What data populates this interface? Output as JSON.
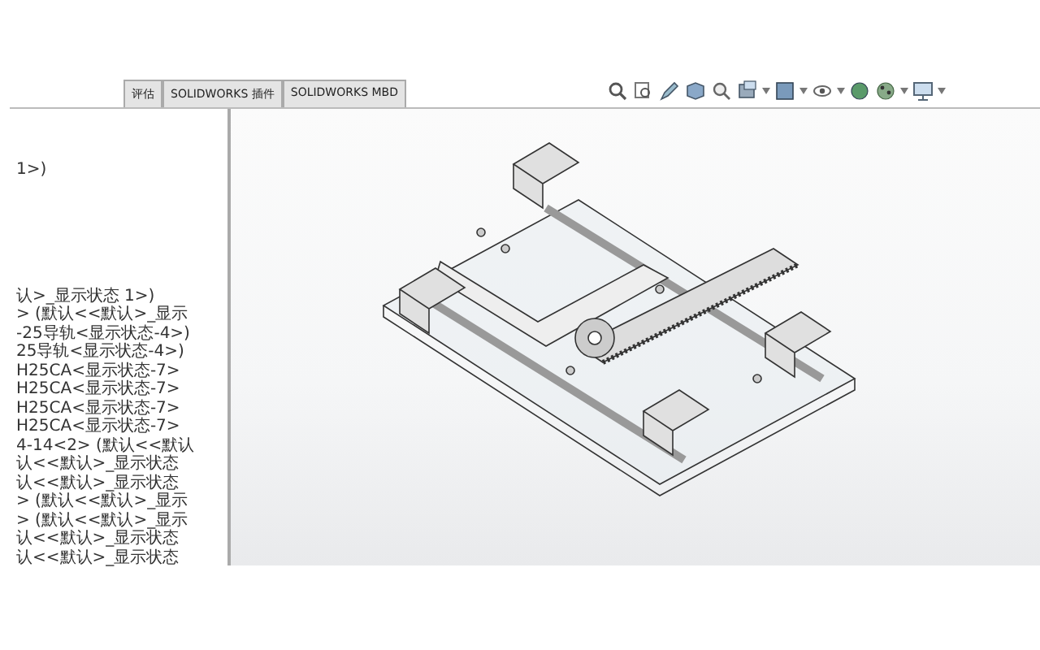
{
  "tabs": [
    {
      "label": "评估",
      "selected": false
    },
    {
      "label": "SOLIDWORKS 插件",
      "selected": false
    },
    {
      "label": "SOLIDWORKS MBD",
      "selected": false
    }
  ],
  "feature_tree": {
    "items": [
      {
        "label": "1>)"
      },
      {
        "label": "认>_显示状态 1>)"
      },
      {
        "label": "> (默认<<默认>_显示"
      },
      {
        "label": "-25导轨<显示状态-4>)"
      },
      {
        "label": "25导轨<显示状态-4>)"
      },
      {
        "label": "H25CA<显示状态-7>"
      },
      {
        "label": "H25CA<显示状态-7>"
      },
      {
        "label": "H25CA<显示状态-7>"
      },
      {
        "label": "H25CA<显示状态-7>"
      },
      {
        "label": "4-14<2> (默认<<默认"
      },
      {
        "label": "认<<默认>_显示状态"
      },
      {
        "label": "认<<默认>_显示状态"
      },
      {
        "label": "> (默认<<默认>_显示"
      },
      {
        "label": "> (默认<<默认>_显示"
      },
      {
        "label": "认<<默认>_显示状态"
      },
      {
        "label": "认<<默认>_显示状态"
      }
    ]
  }
}
